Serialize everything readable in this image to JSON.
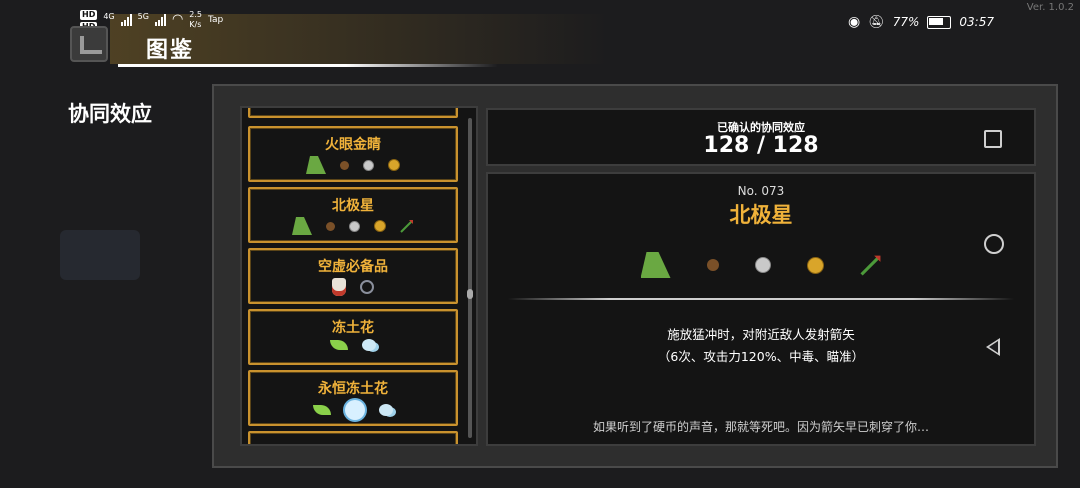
{
  "status_bar": {
    "network_left": [
      "HD",
      "HD"
    ],
    "net_4g": "4G",
    "net_5g": "5G",
    "speed_value": "2.5",
    "speed_unit": "K/s",
    "tap_label": "Tap",
    "battery_percent": "77%",
    "time": "03:57",
    "version": "Ver. 1.0.2"
  },
  "header": {
    "title": "图鉴",
    "section_title": "协同效应"
  },
  "list": {
    "items": [
      {
        "name": "火眼金睛",
        "icons": [
          "cloak-icon",
          "acorn-icon",
          "silver-coin-icon",
          "gold-coin-icon"
        ]
      },
      {
        "name": "北极星",
        "icons": [
          "cloak-icon",
          "acorn-icon",
          "silver-coin-icon",
          "gold-coin-icon",
          "arrow-icon"
        ]
      },
      {
        "name": "空虚必备品",
        "icons": [
          "mask-icon",
          "hook-icon"
        ]
      },
      {
        "name": "冻土花",
        "icons": [
          "leaf-icon",
          "frost-icon"
        ]
      },
      {
        "name": "永恒冻土花",
        "icons": [
          "leaf-icon",
          "frost-orb-icon",
          "frost-icon"
        ]
      }
    ],
    "scroll_position": 0.55
  },
  "summary": {
    "label": "已确认的协同效应",
    "value": "128 / 128"
  },
  "detail": {
    "number": "No. 073",
    "name": "北极星",
    "icons": [
      "cloak-icon",
      "acorn-icon",
      "silver-coin-icon",
      "gold-coin-icon",
      "arrow-icon"
    ],
    "description_line1": "施放猛冲时，对附近敌人发射箭矢",
    "description_line2": "（6次、攻击力120%、中毒、瞄准）",
    "flavor": "如果听到了硬币的声音，那就等死吧。因为箭矢早已刺穿了你…"
  },
  "colors": {
    "accent_gold": "#f0b23a",
    "frame_gold": "#c9922e",
    "panel_bg": "#2e2e2e",
    "box_bg": "#141414"
  }
}
